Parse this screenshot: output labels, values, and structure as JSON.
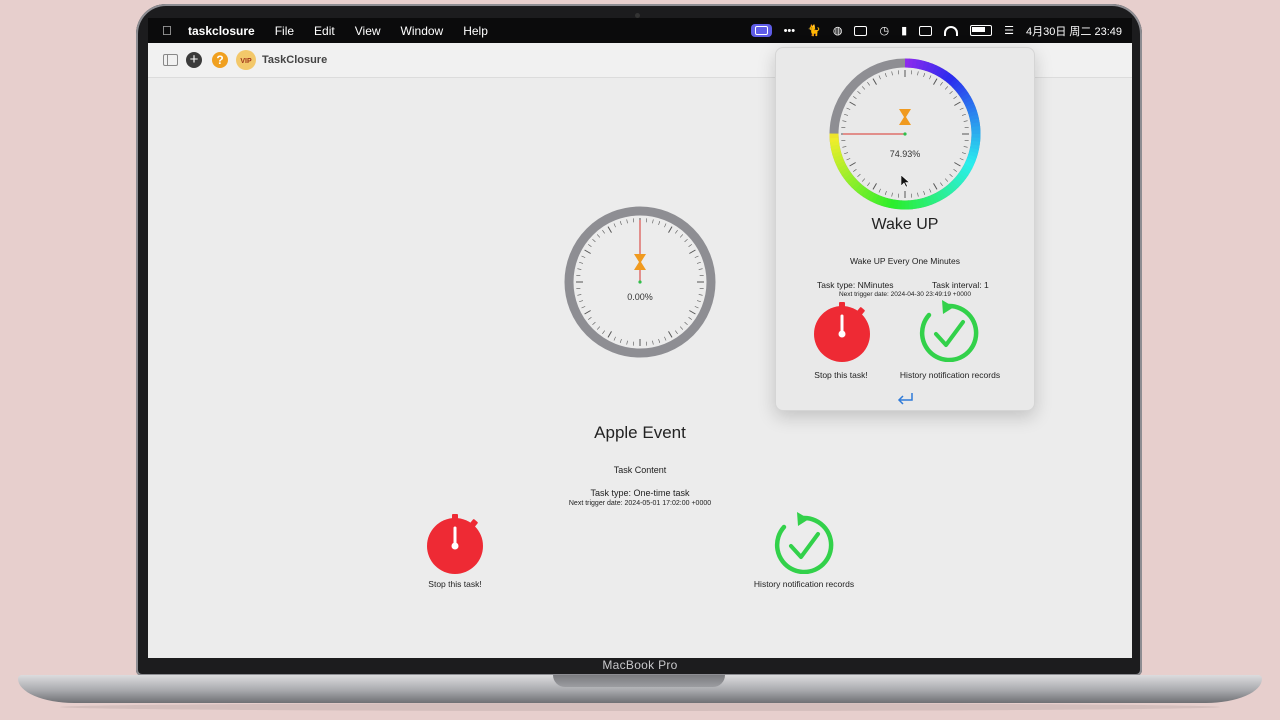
{
  "device": {
    "label": "MacBook Pro"
  },
  "menubar": {
    "app_name": "taskclosure",
    "items": [
      "File",
      "Edit",
      "View",
      "Window",
      "Help"
    ],
    "datetime": "4月30日 周二  23:49"
  },
  "toolbar": {
    "title": "TaskClosure"
  },
  "main_task": {
    "progress": "0.00%",
    "progress_value": 0.0,
    "title": "Apple Event",
    "content": "Task Content",
    "task_type": "Task type:  One-time task",
    "next_trigger": "Next trigger date:   2024-05-01 17:02:00 +0000",
    "stop_label": "Stop this task!",
    "history_label": "History notification records"
  },
  "popover_task": {
    "progress": "74.93%",
    "progress_value": 0.7493,
    "title": "Wake UP",
    "content": "Wake UP Every One Minutes",
    "task_type": "Task type:   NMinutes",
    "task_interval": "Task interval:   1",
    "next_trigger": "Next trigger date:   2024-04-30 23:49:19 +0000",
    "stop_label": "Stop this task!",
    "history_label": "History notification records"
  },
  "colors": {
    "stop_red": "#ee2a34",
    "history_green": "#32d14a",
    "gauge_gray": "#8e8e93",
    "hourglass": "#f09a1f",
    "menubar_active": "#5e5ce6",
    "return_blue": "#2f7bd9"
  }
}
